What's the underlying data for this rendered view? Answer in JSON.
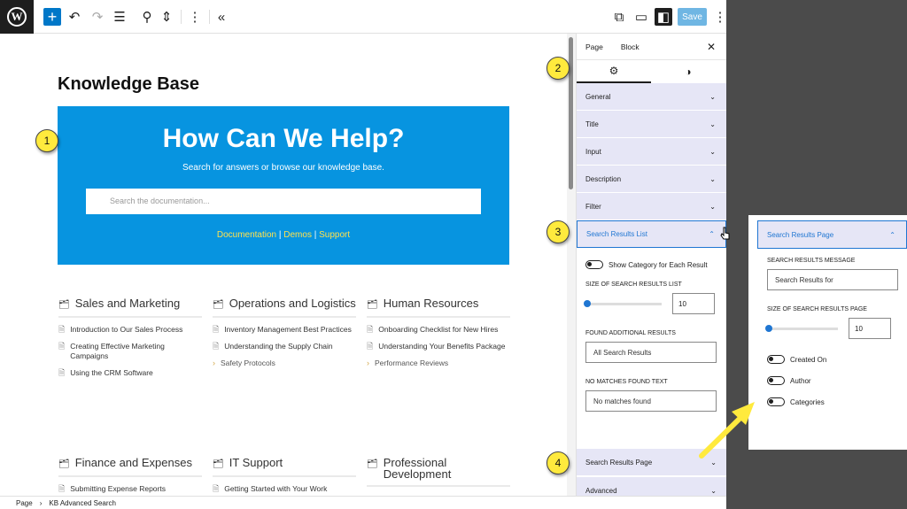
{
  "toolbar": {
    "save_label": "Save"
  },
  "canvas": {
    "page_title": "Knowledge Base",
    "hero": {
      "title": "How Can We Help?",
      "subtitle": "Search for answers or browse our knowledge base.",
      "search_placeholder": "Search the documentation...",
      "link_docs": "Documentation",
      "link_demos": "Demos",
      "link_support": "Support",
      "separator": " | "
    },
    "categories": [
      {
        "title": "Sales and Marketing",
        "items": [
          "Introduction to Our Sales Process",
          "Creating Effective Marketing Campaigns",
          "Using the CRM Software"
        ]
      },
      {
        "title": "Operations and Logistics",
        "items": [
          "Inventory Management Best Practices",
          "Understanding the Supply Chain"
        ],
        "more": "Safety Protocols"
      },
      {
        "title": "Human Resources",
        "items": [
          "Onboarding Checklist for New Hires",
          "Understanding Your Benefits Package"
        ],
        "more": "Performance Reviews"
      },
      {
        "title": "Finance and Expenses",
        "items": [
          "Submitting Expense Reports"
        ]
      },
      {
        "title": "IT Support",
        "items": [
          "Getting Started with Your Work"
        ]
      },
      {
        "title": "Professional Development",
        "items": []
      }
    ]
  },
  "statusbar": {
    "crumb1": "Page",
    "crumb2": "KB Advanced Search",
    "sep": "›"
  },
  "inspector": {
    "tab_page": "Page",
    "tab_block": "Block",
    "sections": [
      "General",
      "Title",
      "Input",
      "Description",
      "Filter"
    ],
    "open_section": "Search Results List",
    "toggle_show_category": "Show Category for Each Result",
    "size_label": "SIZE OF SEARCH RESULTS LIST",
    "size_value": "10",
    "found_label": "FOUND ADDITIONAL RESULTS",
    "found_value": "All Search Results",
    "nomatch_label": "NO MATCHES FOUND TEXT",
    "nomatch_value": "No matches found",
    "section_results_page": "Search Results Page",
    "section_advanced": "Advanced"
  },
  "popout": {
    "section_title": "Search Results Page",
    "message_label": "SEARCH RESULTS MESSAGE",
    "message_value": "Search Results for",
    "size_label": "SIZE OF SEARCH RESULTS PAGE",
    "size_value": "10",
    "toggle_created": "Created On",
    "toggle_author": "Author",
    "toggle_categories": "Categories"
  },
  "badges": [
    "1",
    "2",
    "3",
    "4"
  ],
  "colors": {
    "hero_bg": "#0794e0",
    "accent": "#1f76d2",
    "link_yellow": "#ffe24d",
    "badge_yellow": "#ffea3d"
  }
}
